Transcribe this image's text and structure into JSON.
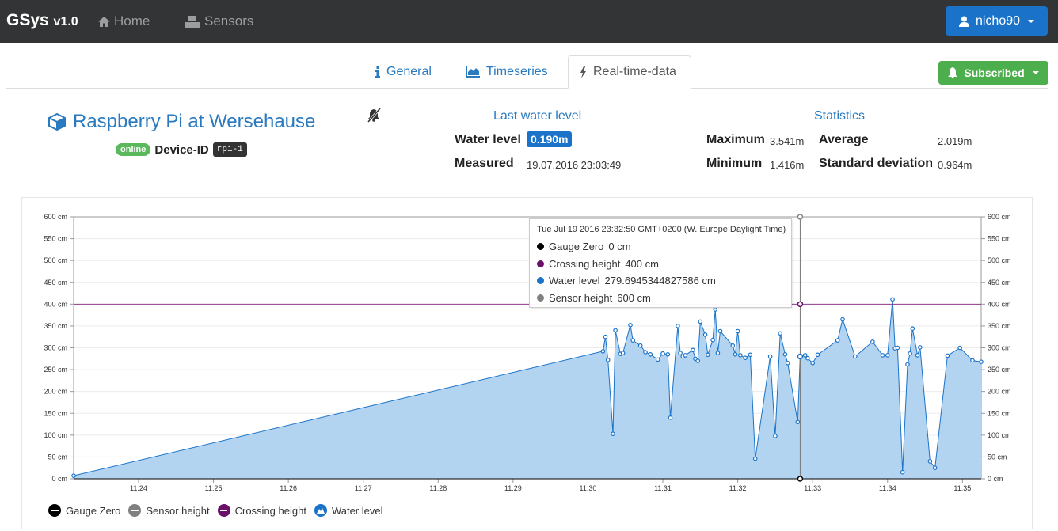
{
  "navbar": {
    "brand": "GSys",
    "version": "v1.0",
    "home_label": "Home",
    "sensors_label": "Sensors",
    "user_label": "nicho90"
  },
  "tabs": [
    {
      "label": "General",
      "icon": "info-icon"
    },
    {
      "label": "Timeseries",
      "icon": "area-chart-icon"
    },
    {
      "label": "Real-time-data",
      "icon": "bolt-icon",
      "active": true
    }
  ],
  "subscribe_label": "Subscribed",
  "device": {
    "title": "Raspberry Pi at Wersehause",
    "status": "online",
    "id_label": "Device-ID",
    "id": "rpi-1"
  },
  "last_water_level": {
    "heading": "Last water level",
    "water_level_label": "Water level",
    "water_level_value": "0.190m",
    "measured_label": "Measured",
    "measured_value": "19.07.2016 23:03:49"
  },
  "statistics": {
    "heading": "Statistics",
    "maximum_label": "Maximum",
    "maximum_value": "3.541m",
    "minimum_label": "Minimum",
    "minimum_value": "1.416m",
    "average_label": "Average",
    "average_value": "2.019m",
    "stddev_label": "Standard deviation",
    "stddev_value": "0.964m"
  },
  "tooltip": {
    "header": "Tue Jul 19 2016 23:32:50 GMT+0200 (W. Europe Daylight Time)",
    "rows": [
      {
        "label": "Gauge Zero",
        "value": "0 cm",
        "color": "#000000"
      },
      {
        "label": "Crossing height",
        "value": "400 cm",
        "color": "#6b0f6b"
      },
      {
        "label": "Water level",
        "value": "279.6945344827586 cm",
        "color": "#1a73c9"
      },
      {
        "label": "Sensor height",
        "value": "600 cm",
        "color": "#808080"
      }
    ]
  },
  "legend": [
    {
      "label": "Gauge Zero",
      "color": "#000000"
    },
    {
      "label": "Sensor height",
      "color": "#808080"
    },
    {
      "label": "Crossing height",
      "color": "#6b0f6b"
    },
    {
      "label": "Water level",
      "color": "#1a73c9"
    }
  ],
  "colors": {
    "primary": "#1a73c9",
    "success": "#4cae4c",
    "navbar": "#333436",
    "water_fill": "#b3d4f0"
  },
  "chart_data": {
    "type": "area",
    "x_unit": "time (hh:mm)",
    "y_unit": "cm",
    "x_ticks": [
      "11:24",
      "11:25",
      "11:26",
      "11:27",
      "11:28",
      "11:29",
      "11:30",
      "11:31",
      "11:32",
      "11:33",
      "11:34",
      "11:35"
    ],
    "y_ticks": [
      "0 cm",
      "50 cm",
      "100 cm",
      "150 cm",
      "200 cm",
      "250 cm",
      "300 cm",
      "350 cm",
      "400 cm",
      "450 cm",
      "500 cm",
      "550 cm",
      "600 cm"
    ],
    "xlim": [
      "11:23:08",
      "11:35:15"
    ],
    "ylim": [
      0,
      600
    ],
    "grid": true,
    "legend_position": "bottom-left",
    "crosshair_time": "11:32:50",
    "series": [
      {
        "name": "Gauge Zero",
        "type": "line",
        "values": [
          0
        ]
      },
      {
        "name": "Sensor height",
        "type": "line",
        "values": [
          600
        ]
      },
      {
        "name": "Crossing height",
        "type": "line",
        "values": [
          400
        ]
      },
      {
        "name": "Water level",
        "type": "area",
        "points": [
          [
            "11:23:08",
            7
          ],
          [
            "11:30:12",
            292
          ],
          [
            "11:30:14",
            325
          ],
          [
            "11:30:16",
            272
          ],
          [
            "11:30:20",
            103
          ],
          [
            "11:30:22",
            340
          ],
          [
            "11:30:26",
            286
          ],
          [
            "11:30:28",
            288
          ],
          [
            "11:30:34",
            352
          ],
          [
            "11:30:36",
            317
          ],
          [
            "11:30:42",
            305
          ],
          [
            "11:30:46",
            290
          ],
          [
            "11:30:50",
            285
          ],
          [
            "11:30:56",
            273
          ],
          [
            "11:31:00",
            287
          ],
          [
            "11:31:04",
            285
          ],
          [
            "11:31:06",
            140
          ],
          [
            "11:31:12",
            350
          ],
          [
            "11:31:14",
            288
          ],
          [
            "11:31:16",
            280
          ],
          [
            "11:31:18",
            283
          ],
          [
            "11:31:24",
            295
          ],
          [
            "11:31:26",
            275
          ],
          [
            "11:31:28",
            270
          ],
          [
            "11:31:30",
            360
          ],
          [
            "11:31:34",
            330
          ],
          [
            "11:31:36",
            284
          ],
          [
            "11:31:40",
            318
          ],
          [
            "11:31:42",
            388
          ],
          [
            "11:31:44",
            288
          ],
          [
            "11:31:46",
            338
          ],
          [
            "11:31:56",
            305
          ],
          [
            "11:31:58",
            285
          ],
          [
            "11:32:00",
            338
          ],
          [
            "11:32:02",
            283
          ],
          [
            "11:32:06",
            277
          ],
          [
            "11:32:10",
            284
          ],
          [
            "11:32:14",
            46
          ],
          [
            "11:32:26",
            280
          ],
          [
            "11:32:30",
            98
          ],
          [
            "11:32:34",
            333
          ],
          [
            "11:32:38",
            285
          ],
          [
            "11:32:40",
            265
          ],
          [
            "11:32:48",
            130
          ],
          [
            "11:32:50",
            280
          ],
          [
            "11:32:54",
            283
          ],
          [
            "11:32:56",
            276
          ],
          [
            "11:33:00",
            265
          ],
          [
            "11:33:04",
            284
          ],
          [
            "11:33:20",
            317
          ],
          [
            "11:33:24",
            365
          ],
          [
            "11:33:34",
            280
          ],
          [
            "11:33:48",
            314
          ],
          [
            "11:33:56",
            283
          ],
          [
            "11:34:00",
            283
          ],
          [
            "11:34:04",
            411
          ],
          [
            "11:34:06",
            299
          ],
          [
            "11:34:08",
            300
          ],
          [
            "11:34:12",
            15
          ],
          [
            "11:34:16",
            262
          ],
          [
            "11:34:18",
            287
          ],
          [
            "11:34:20",
            344
          ],
          [
            "11:34:24",
            283
          ],
          [
            "11:34:26",
            301
          ],
          [
            "11:34:34",
            40
          ],
          [
            "11:34:38",
            25
          ],
          [
            "11:34:48",
            282
          ],
          [
            "11:34:58",
            300
          ],
          [
            "11:35:08",
            271
          ],
          [
            "11:35:15",
            268
          ]
        ]
      }
    ]
  }
}
